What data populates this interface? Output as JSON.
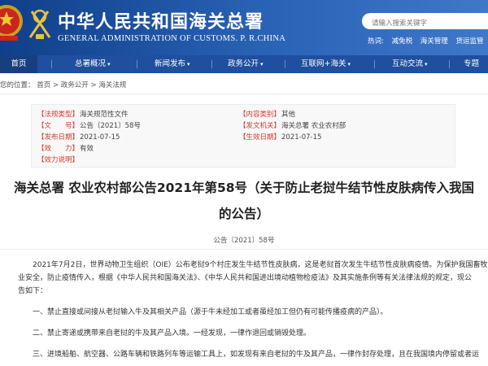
{
  "header": {
    "title_cn": "中华人民共和国海关总署",
    "title_en": "GENERAL ADMINISTRATION OF CUSTOMS. P. R.CHINA",
    "search_placeholder": "请输入搜索关键字",
    "hot_label": "热词:",
    "hot_words": [
      "减免税",
      "海关管理",
      "货运监管",
      "统计"
    ]
  },
  "nav": {
    "items": [
      {
        "label": "首页"
      },
      {
        "label": "总署概况"
      },
      {
        "label": "新闻发布"
      },
      {
        "label": "政务公开"
      },
      {
        "label": "互联网+海关"
      },
      {
        "label": "互动交流"
      },
      {
        "label": "专题"
      }
    ]
  },
  "breadcrumb": {
    "prefix": "您的位置：",
    "items": [
      "首页",
      "政务公开",
      "海关法规"
    ],
    "sep": ">"
  },
  "meta": {
    "fields": [
      {
        "key": "【法规类型】",
        "value": "海关规范性文件"
      },
      {
        "key": "【内容类别】",
        "value": "其他"
      },
      {
        "key": "【文　　号】",
        "value": "公告〔2021〕58号"
      },
      {
        "key": "【发文机关】",
        "value": "海关总署 农业农村部"
      },
      {
        "key": "【发布日期】",
        "value": "2021-07-15"
      },
      {
        "key": "【生效日期】",
        "value": "2021-07-15"
      },
      {
        "key": "【效　　力】",
        "value": "有效"
      },
      {
        "key": "【效力说明】",
        "value": ""
      }
    ]
  },
  "article": {
    "title_line1": "海关总署 农业农村部公告2021年第58号（关于防止老挝牛结节性皮肤病传入我国",
    "title_line2": "的公告）",
    "doc_no": "公告〔2021〕58号",
    "para1_line1": "2021年7月2日，世界动物卫生组织（OIE）公布老挝9个村庄发生牛结节性皮肤病，这是老挝首次发生牛结节性皮肤病疫情。为保护我国畜牧",
    "para1_line2": "业安全，防止疫情传入，根据《中华人民共和国海关法》、《中华人民共和国进出境动植物检疫法》及其实施条例等有关法律法规的规定，现公",
    "para1_line3": "告如下：",
    "item1": "一、禁止直接或间接从老挝输入牛及其相关产品（源于牛未经加工或者虽经加工但仍有可能传播疫病的产品）。",
    "item2": "二、禁止寄递或携带来自老挝的牛及其产品入境。一经发现，一律作退回或销毁处理。",
    "item3": "三、进境船舶、航空器、公路车辆和铁路列车等运输工具上，如发现有来自老挝的牛及其产品，一律作封存处理，且在我国境内停留或者运"
  },
  "colors": {
    "header_blue": "#1f4f9e",
    "meta_key_red": "#d23a2a"
  }
}
